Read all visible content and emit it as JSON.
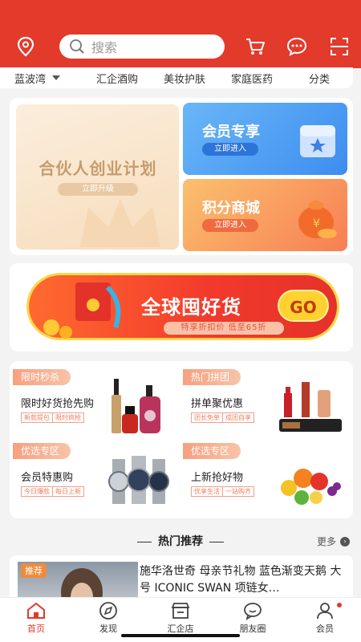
{
  "header": {
    "search_placeholder": "搜索",
    "icons": [
      "location-pin-icon",
      "search-icon",
      "cart-icon",
      "message-icon",
      "scan-icon"
    ]
  },
  "catbar": {
    "location": "蓝波湾",
    "items": [
      "汇企酒购",
      "美妆护肤",
      "家庭医药",
      "分类"
    ]
  },
  "features": {
    "partner": {
      "title": "合伙人创业计划",
      "button": "立即升级"
    },
    "member": {
      "title": "会员专享",
      "button": "立即进入"
    },
    "points": {
      "title": "积分商城",
      "button": "立即进入"
    }
  },
  "banner": {
    "title": "全球囤好货",
    "subtitle": "特享折扣价 低至65折",
    "go": "GO"
  },
  "promos": [
    {
      "tag": "限时秒杀",
      "title": "限时好货抢先购",
      "subs": [
        "新款提包",
        "限时疯抢"
      ]
    },
    {
      "tag": "热门拼团",
      "title": "拼单聚优惠",
      "subs": [
        "团长免单",
        "成团自享"
      ]
    },
    {
      "tag": "优选专区",
      "title": "会员特惠购",
      "subs": [
        "今日爆款",
        "每日上新"
      ]
    },
    {
      "tag": "优选专区",
      "title": "上新抢好物",
      "subs": [
        "优享生活",
        "一站购齐"
      ]
    }
  ],
  "hot": {
    "title": "热门推荐",
    "more": "更多",
    "more_icon": "›"
  },
  "product": {
    "tag": "推荐",
    "title": "施华洛世奇 母亲节礼物 蓝色渐变天鹅 大号 ICONIC SWAN 项链女…"
  },
  "tabs": [
    {
      "label": "首页",
      "active": true
    },
    {
      "label": "发现"
    },
    {
      "label": "汇企店"
    },
    {
      "label": "朋友圈"
    },
    {
      "label": "会员",
      "badge": true
    }
  ],
  "colors": {
    "brand": "#e23a2b",
    "gold": "#c79b6d",
    "blue": "#3d8df0",
    "orange": "#f77e54"
  }
}
